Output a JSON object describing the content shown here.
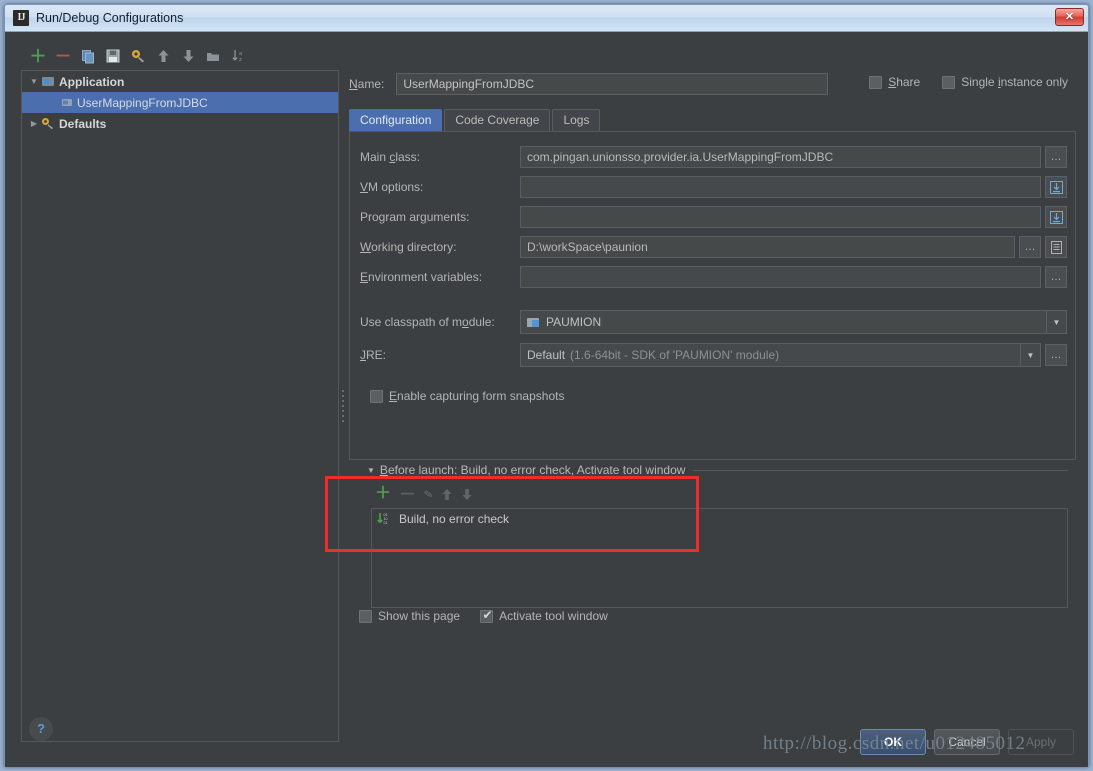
{
  "window": {
    "title": "Run/Debug Configurations",
    "app_icon": "intellij-idea-icon",
    "close_label": "✕"
  },
  "tree_toolbar": [
    {
      "name": "add-configuration-button",
      "glyph": "＋"
    },
    {
      "name": "remove-configuration-button",
      "glyph": "－"
    },
    {
      "name": "copy-configuration-button",
      "glyph": "❐"
    },
    {
      "name": "save-configuration-button",
      "glyph": "▤"
    },
    {
      "name": "edit-defaults-button",
      "glyph": "⚒"
    },
    {
      "name": "move-up-button",
      "glyph": "⬆"
    },
    {
      "name": "move-down-button",
      "glyph": "⬇"
    },
    {
      "name": "create-folder-button",
      "glyph": "▰"
    },
    {
      "name": "sort-configurations-button",
      "glyph": "↓ᴀᴢ"
    }
  ],
  "tree": {
    "nodes": [
      {
        "label": "Application",
        "expander": "▼",
        "icon": "application-icon",
        "level": 0,
        "selected": false,
        "bold": true
      },
      {
        "label": "UserMappingFromJDBC",
        "expander": "",
        "icon": "run-config-icon",
        "level": 1,
        "selected": true,
        "bold": false
      },
      {
        "label": "Defaults",
        "expander": "▶",
        "icon": "defaults-wrench-icon",
        "level": 0,
        "selected": false,
        "bold": true
      }
    ]
  },
  "name_field": {
    "label": "Name:",
    "label_mnemonic": "N",
    "value": "UserMappingFromJDBC"
  },
  "top_checkboxes": [
    {
      "name": "share-checkbox",
      "label": "Share",
      "mnemonic": "S",
      "checked": false
    },
    {
      "name": "single-instance-checkbox",
      "label": "Single instance only",
      "mnemonic": "i",
      "checked": false
    }
  ],
  "tabs": [
    {
      "label": "Configuration",
      "active": true
    },
    {
      "label": "Code Coverage",
      "active": false
    },
    {
      "label": "Logs",
      "active": false
    }
  ],
  "configuration": {
    "main_class": {
      "label": "Main class:",
      "mnemonic": "c",
      "value": "com.pingan.unionsso.provider.ia.UserMappingFromJDBC",
      "browse": "…"
    },
    "vm_options": {
      "label": "VM options:",
      "mnemonic": "V",
      "value": "",
      "expand": "⤓"
    },
    "program_arguments": {
      "label": "Program arguments:",
      "mnemonic": "g",
      "value": "",
      "expand": "⤓"
    },
    "working_directory": {
      "label": "Working directory:",
      "mnemonic": "W",
      "value": "D:\\workSpace\\paunion",
      "browse": "…",
      "macro": "▤"
    },
    "environment_variables": {
      "label": "Environment variables:",
      "mnemonic": "E",
      "value": "",
      "browse": "…"
    },
    "use_classpath_of_module": {
      "label": "Use classpath of module:",
      "mnemonic": "o",
      "value": "PAUMION",
      "arrow": "▼"
    },
    "jre": {
      "label": "JRE:",
      "mnemonic": "J",
      "value": "Default",
      "value_detail": "(1.6-64bit - SDK of 'PAUMION' module)",
      "arrow": "▼",
      "browse": "…"
    },
    "enable_snapshots": {
      "label": "Enable capturing form snapshots",
      "mnemonic": "E",
      "checked": false
    }
  },
  "before_launch": {
    "expander": "▼",
    "title": "Before launch: Build, no error check, Activate tool window",
    "title_mnemonic": "B",
    "toolbar": [
      {
        "name": "add-before-launch-task-button",
        "glyph": "＋",
        "enabled": true
      },
      {
        "name": "remove-before-launch-task-button",
        "glyph": "－",
        "enabled": false
      },
      {
        "name": "edit-before-launch-task-button",
        "glyph": "✎",
        "enabled": false
      },
      {
        "name": "move-task-up-button",
        "glyph": "⬆",
        "enabled": false
      },
      {
        "name": "move-task-down-button",
        "glyph": "⬇",
        "enabled": false
      }
    ],
    "tasks": [
      {
        "label": "Build, no error check",
        "icon": "build-icon"
      }
    ]
  },
  "bottom_checkboxes": [
    {
      "name": "show-this-page-checkbox",
      "label": "Show this page",
      "checked": false
    },
    {
      "name": "activate-tool-window-checkbox",
      "label": "Activate tool window",
      "checked": true
    }
  ],
  "footer": {
    "help_glyph": "?",
    "buttons": [
      {
        "name": "ok-button",
        "label": "OK",
        "style": "default"
      },
      {
        "name": "cancel-button",
        "label": "Cancel",
        "style": "normal"
      },
      {
        "name": "apply-button",
        "label": "Apply",
        "style": "disabled"
      }
    ]
  },
  "watermark": "http://blog.csdn.net/u012485012",
  "colors": {
    "window_bg": "#3c3f41",
    "selection_blue": "#4b6eaf",
    "highlight_red": "#ef2b2b",
    "accent_green": "#4f9e4f",
    "titlebar_text": "#12202e"
  }
}
